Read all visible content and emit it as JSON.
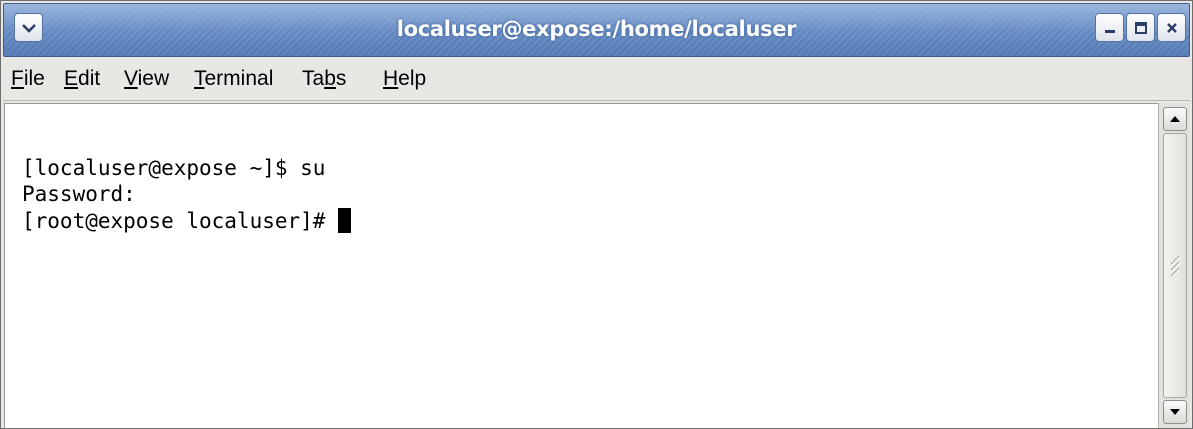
{
  "window": {
    "title": "localuser@expose:/home/localuser"
  },
  "titlebar_buttons": {
    "menu_icon": "chevron-down-icon",
    "minimize_icon": "minimize-icon",
    "maximize_icon": "maximize-icon",
    "close_icon": "close-icon"
  },
  "menubar": {
    "items": [
      {
        "label": "File",
        "mnemonic": "F"
      },
      {
        "label": "Edit",
        "mnemonic": "E"
      },
      {
        "label": "View",
        "mnemonic": "V"
      },
      {
        "label": "Terminal",
        "mnemonic": "T"
      },
      {
        "label": "Tabs",
        "mnemonic": "b"
      },
      {
        "label": "Help",
        "mnemonic": "H"
      }
    ]
  },
  "terminal": {
    "lines": [
      "[localuser@expose ~]$ su",
      "Password:",
      "[root@expose localuser]# "
    ],
    "background": "#ffffff",
    "foreground": "#000000"
  },
  "scrollbar": {
    "up_icon": "arrow-up-icon",
    "down_icon": "arrow-down-icon"
  },
  "colors": {
    "titlebar": "#6d93c8",
    "menubar": "#e8e7e4"
  }
}
